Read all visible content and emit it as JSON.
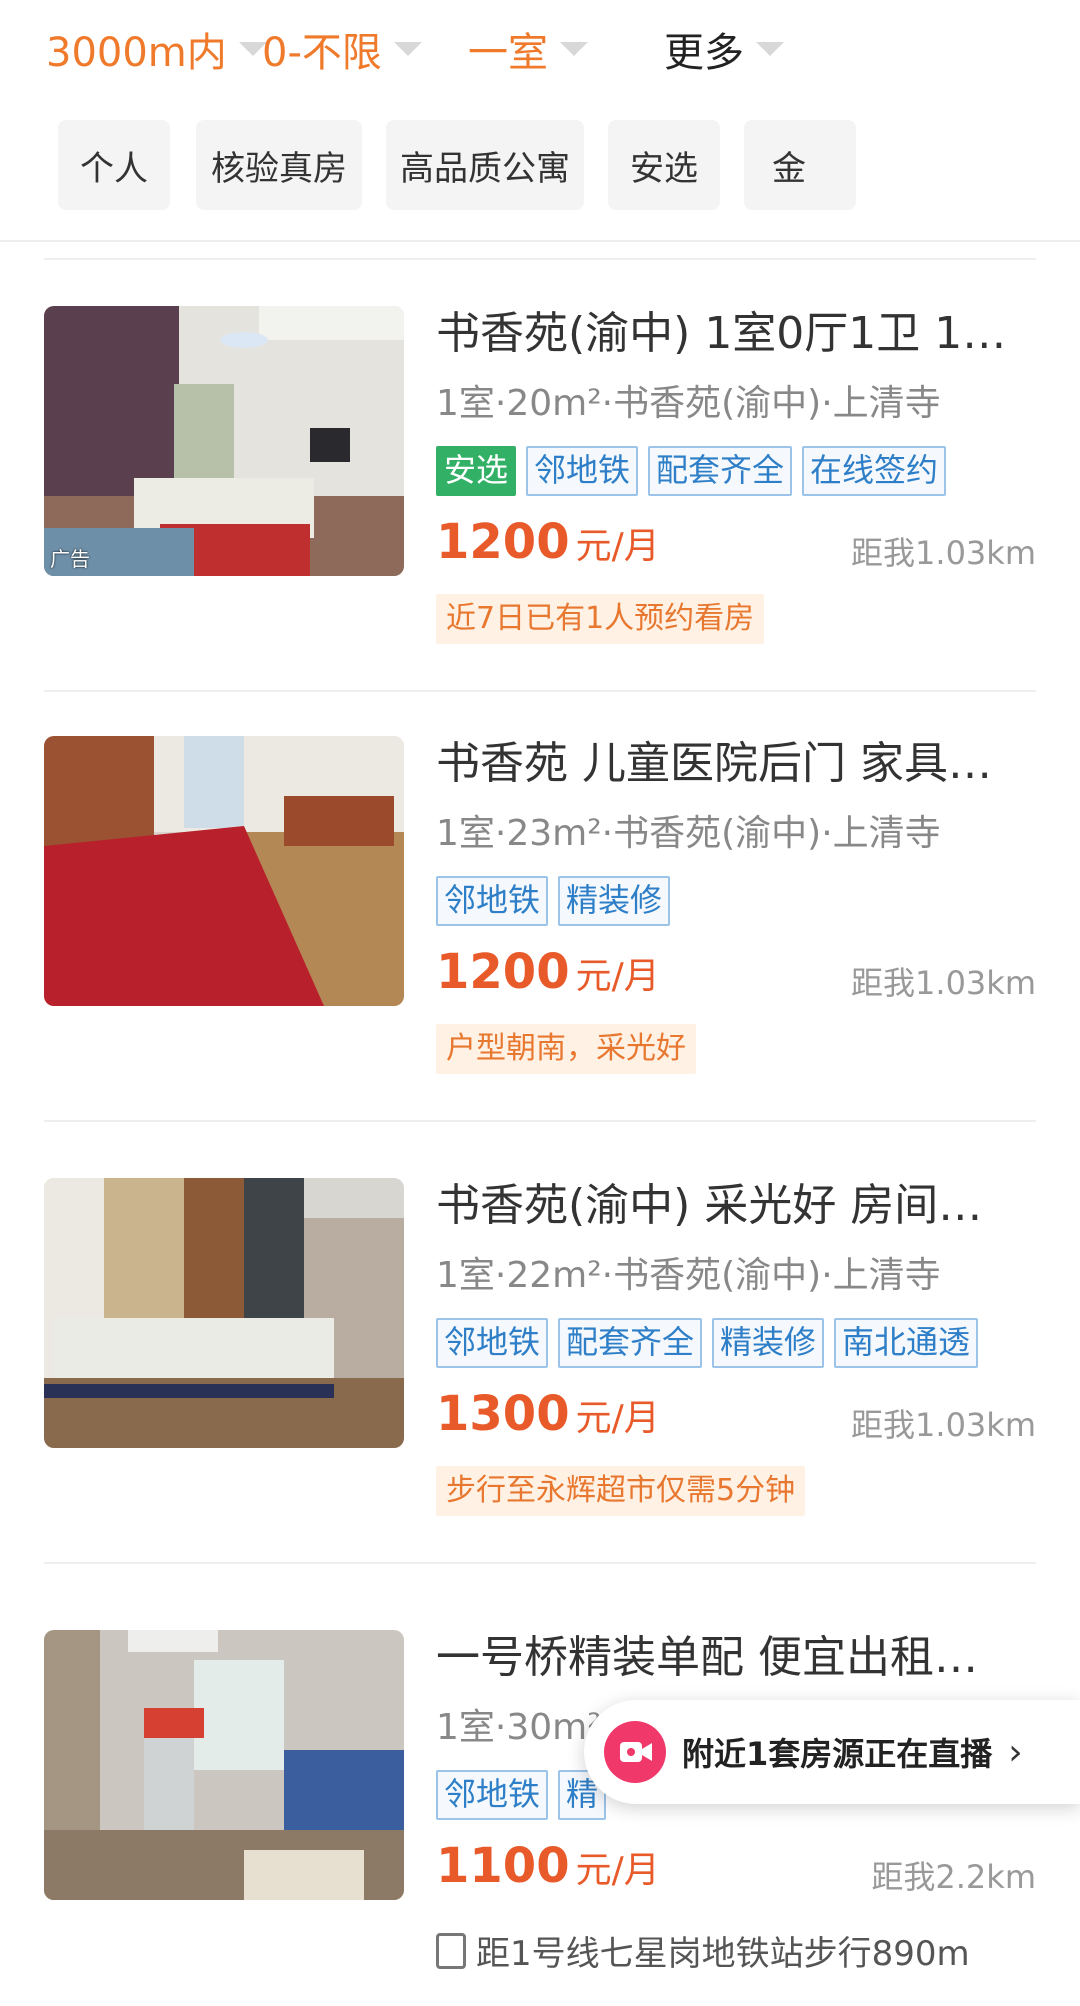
{
  "filters": [
    {
      "label": "3000m内"
    },
    {
      "label": "0-不限"
    },
    {
      "label": "一室"
    },
    {
      "label": "更多"
    }
  ],
  "chips": [
    "个人",
    "核验真房",
    "高品质公寓",
    "安选",
    "金"
  ],
  "listings": [
    {
      "title": "书香苑(渝中) 1室0厅1卫 1…",
      "meta": "1室·20m²·书香苑(渝中)·上清寺",
      "tags": [
        "安选",
        "邻地铁",
        "配套齐全",
        "在线签约"
      ],
      "price": "1200",
      "unit": "元/月",
      "distance": "距我1.03km",
      "note": "近7日已有1人预约看房",
      "ad_label": "广告"
    },
    {
      "title": "书香苑 儿童医院后门 家具…",
      "meta": "1室·23m²·书香苑(渝中)·上清寺",
      "tags": [
        "邻地铁",
        "精装修"
      ],
      "price": "1200",
      "unit": "元/月",
      "distance": "距我1.03km",
      "note": "户型朝南，采光好"
    },
    {
      "title": "书香苑(渝中) 采光好 房间…",
      "meta": "1室·22m²·书香苑(渝中)·上清寺",
      "tags": [
        "邻地铁",
        "配套齐全",
        "精装修",
        "南北通透"
      ],
      "price": "1300",
      "unit": "元/月",
      "distance": "距我1.03km",
      "note": "步行至永辉超市仅需5分钟"
    },
    {
      "title": "一号桥精装单配  便宜出租…",
      "meta": "1室·30m²·聚丰锦绣盛世·一号桥",
      "tags": [
        "邻地铁",
        "精"
      ],
      "price": "1100",
      "unit": "元/月",
      "distance": "距我2.2km",
      "metro": "距1号线七星岗地铁站步行890m"
    }
  ],
  "live_banner": {
    "text": "附近1套房源正在直播",
    "arrow": "›"
  },
  "colors": {
    "accent": "#e85a2a",
    "filter_active": "#f07a2b",
    "tag_blue": "#2e7fc7",
    "tag_green": "#31b066"
  }
}
